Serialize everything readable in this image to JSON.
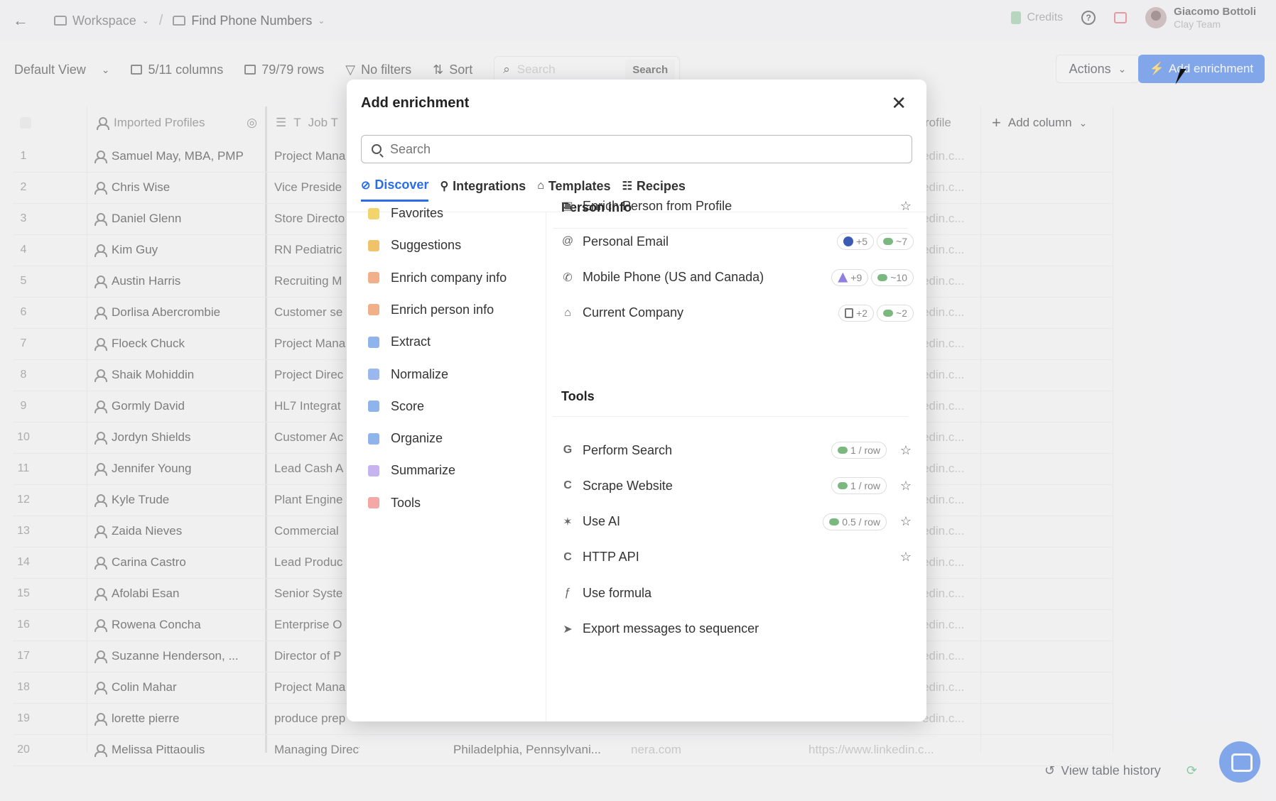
{
  "topbar": {
    "workspace": "Workspace",
    "table_name": "Find Phone Numbers",
    "credits": "Credits",
    "user_name": "Giacomo Bottoli",
    "user_team": "Clay Team"
  },
  "toolbar": {
    "view": "Default View",
    "columns": "5/11 columns",
    "rows": "79/79 rows",
    "filters": "No filters",
    "sort": "Sort",
    "search_placeholder": "Search",
    "search_button": "Search",
    "actions": "Actions",
    "add_enrichment": "Add enrichment"
  },
  "table": {
    "headers": {
      "name": "Imported Profiles",
      "job": "Job T",
      "profile": "rofile",
      "add_column": "Add column"
    },
    "rows": [
      {
        "n": "1",
        "name": "Samuel May, MBA, PMP",
        "job": "Project Mana",
        "li": "edin.c..."
      },
      {
        "n": "2",
        "name": "Chris Wise",
        "job": "Vice Preside",
        "li": "edin.c..."
      },
      {
        "n": "3",
        "name": "Daniel Glenn",
        "job": "Store Directo",
        "li": "edin.c..."
      },
      {
        "n": "4",
        "name": "Kim Guy",
        "job": "RN Pediatric",
        "li": "edin.c..."
      },
      {
        "n": "5",
        "name": "Austin Harris",
        "job": "Recruiting M",
        "li": "edin.c..."
      },
      {
        "n": "6",
        "name": "Dorlisa Abercrombie",
        "job": "Customer se",
        "li": "edin.c..."
      },
      {
        "n": "7",
        "name": "Floeck Chuck",
        "job": "Project Mana",
        "li": "edin.c..."
      },
      {
        "n": "8",
        "name": "Shaik Mohiddin",
        "job": "Project Direc",
        "li": "edin.c..."
      },
      {
        "n": "9",
        "name": "Gormly David",
        "job": "HL7 Integrat",
        "li": "edin.c..."
      },
      {
        "n": "10",
        "name": "Jordyn Shields",
        "job": "Customer Ac",
        "li": "edin.c..."
      },
      {
        "n": "11",
        "name": "Jennifer Young",
        "job": "Lead Cash A",
        "li": "edin.c..."
      },
      {
        "n": "12",
        "name": "Kyle Trude",
        "job": "Plant Engine",
        "li": "edin.c..."
      },
      {
        "n": "13",
        "name": "Zaida Nieves",
        "job": "Commercial",
        "li": "edin.c..."
      },
      {
        "n": "14",
        "name": "Carina Castro",
        "job": "Lead Produc",
        "li": "edin.c..."
      },
      {
        "n": "15",
        "name": "Afolabi Esan",
        "job": "Senior Syste",
        "li": "edin.c..."
      },
      {
        "n": "16",
        "name": "Rowena Concha",
        "job": "Enterprise O",
        "li": "edin.c..."
      },
      {
        "n": "17",
        "name": "Suzanne Henderson, ...",
        "job": "Director of P",
        "li": "edin.c..."
      },
      {
        "n": "18",
        "name": "Colin Mahar",
        "job": "Project Mana",
        "li": "edin.c..."
      },
      {
        "n": "19",
        "name": "lorette pierre",
        "job": "produce prep",
        "li": "edin.c..."
      },
      {
        "n": "20",
        "name": "Melissa Pittaoulis",
        "job": "Managing Director",
        "li": "https://www.linkedin.c...",
        "location": "Philadelphia, Pennsylvani...",
        "domain": "nera.com"
      }
    ]
  },
  "bottom": {
    "history": "View table history"
  },
  "modal": {
    "title": "Add enrichment",
    "search_placeholder": "Search",
    "tabs": [
      {
        "label": "Discover",
        "icon": "compass-icon"
      },
      {
        "label": "Integrations",
        "icon": "plug-icon"
      },
      {
        "label": "Templates",
        "icon": "template-icon"
      },
      {
        "label": "Recipes",
        "icon": "list-icon"
      }
    ],
    "categories": [
      {
        "label": "Favorites",
        "color": "#f3d36b"
      },
      {
        "label": "Suggestions",
        "color": "#f0c36a"
      },
      {
        "label": "Enrich company info",
        "color": "#f2b08a"
      },
      {
        "label": "Enrich person info",
        "color": "#f2b08a"
      },
      {
        "label": "Extract",
        "color": "#8fb4ec"
      },
      {
        "label": "Normalize",
        "color": "#9ab8ee"
      },
      {
        "label": "Score",
        "color": "#8fb4ec"
      },
      {
        "label": "Organize",
        "color": "#8fb4ec"
      },
      {
        "label": "Summarize",
        "color": "#c6b3ef"
      },
      {
        "label": "Tools",
        "color": "#f3a7a7"
      }
    ],
    "person_info": {
      "heading": "Person info",
      "items": [
        {
          "label": "Enrich Person from Profile",
          "icon": "profile-icon"
        },
        {
          "label": "Personal Email",
          "icon": "at-icon",
          "pill1": "+5",
          "pill2": "~7"
        },
        {
          "label": "Mobile Phone (US and Canada)",
          "icon": "phone-icon",
          "pill1": "+9",
          "pill2": "~10"
        },
        {
          "label": "Current Company",
          "icon": "building-icon",
          "pill1": "+2",
          "pill2": "~2"
        }
      ]
    },
    "tools": {
      "heading": "Tools",
      "items": [
        {
          "label": "Perform Search",
          "icon": "google-icon",
          "pill": "1 / row"
        },
        {
          "label": "Scrape Website",
          "icon": "clay-icon",
          "pill": "1 / row"
        },
        {
          "label": "Use AI",
          "icon": "ai-icon",
          "pill": "0.5 / row"
        },
        {
          "label": "HTTP API",
          "icon": "clay-icon"
        },
        {
          "label": "Use formula",
          "icon": "formula-icon"
        },
        {
          "label": "Export messages to sequencer",
          "icon": "send-icon"
        }
      ]
    }
  }
}
